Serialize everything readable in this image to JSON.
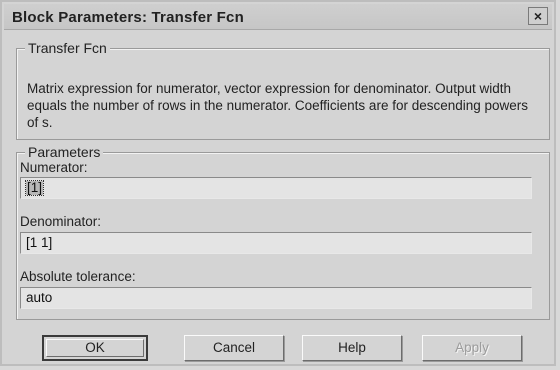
{
  "window": {
    "title": "Block Parameters: Transfer Fcn",
    "close_glyph": "×"
  },
  "block_group": {
    "legend": "Transfer Fcn",
    "description": "Matrix expression for numerator, vector expression for denominator. Output width equals the number of rows in the numerator.  Coefficients are for descending powers of s."
  },
  "parameters": {
    "legend": "Parameters",
    "numerator_label": "Numerator:",
    "numerator_value": "[1]",
    "denominator_label": "Denominator:",
    "denominator_value": "[1 1]",
    "tolerance_label": "Absolute tolerance:",
    "tolerance_value": "auto"
  },
  "buttons": {
    "ok": "OK",
    "cancel": "Cancel",
    "help": "Help",
    "apply": "Apply"
  }
}
